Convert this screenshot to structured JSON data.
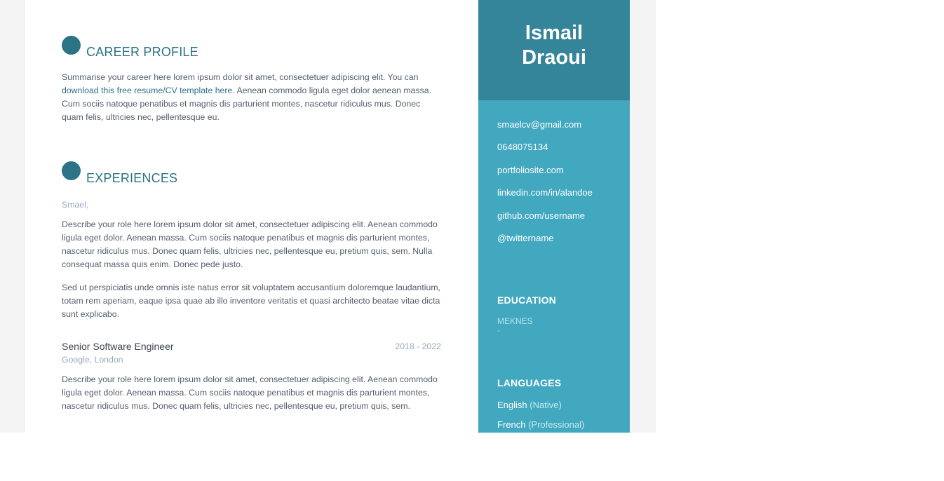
{
  "profile": {
    "first_name": "Ismail",
    "last_name": "Draoui",
    "contact": [
      {
        "label": "smaelcv@gmail.com",
        "icon": "email-icon"
      },
      {
        "label": "0648075134",
        "icon": "phone-icon"
      },
      {
        "label": "portfoliosite.com",
        "icon": "globe-icon"
      },
      {
        "label": "linkedin.com/in/alandoe",
        "icon": "linkedin-icon"
      },
      {
        "label": "github.com/username",
        "icon": "github-icon"
      },
      {
        "label": "@twittername",
        "icon": "twitter-icon"
      }
    ]
  },
  "education": {
    "heading": "EDUCATION",
    "school": "MEKNES",
    "detail": "-"
  },
  "languages": {
    "heading": "LANGUAGES",
    "items": [
      {
        "name": "English",
        "level": "(Native)"
      },
      {
        "name": "French",
        "level": "(Professional)"
      }
    ]
  },
  "career": {
    "heading": "CAREER PROFILE",
    "text_before": "Summarise your career here lorem ipsum dolor sit amet, consectetuer adipiscing elit. You can ",
    "link_text": "download this free resume/CV template here",
    "text_after": ". Aenean commodo ligula eget dolor aenean massa. Cum sociis natoque penatibus et magnis dis parturient montes, nascetur ridiculus mus. Donec quam felis, ultricies nec, pellentesque eu."
  },
  "experiences": {
    "heading": "EXPERIENCES",
    "entry1": {
      "subtitle": "Smael,",
      "paragraph1": "Describe your role here lorem ipsum dolor sit amet, consectetuer adipiscing elit. Aenean commodo ligula eget dolor. Aenean massa. Cum sociis natoque penatibus et magnis dis parturient montes, nascetur ridiculus mus. Donec quam felis, ultricies nec, pellentesque eu, pretium quis, sem. Nulla consequat massa quis enim. Donec pede justo.",
      "paragraph2": "Sed ut perspiciatis unde omnis iste natus error sit voluptatem accusantium doloremque laudantium, totam rem aperiam, eaque ipsa quae ab illo inventore veritatis et quasi architecto beatae vitae dicta sunt explicabo."
    },
    "entry2": {
      "title": "Senior Software Engineer",
      "dates": "2018 - 2022",
      "company": "Google, London",
      "paragraph": "Describe your role here lorem ipsum dolor sit amet, consectetuer adipiscing elit. Aenean commodo ligula eget dolor. Aenean massa. Cum sociis natoque penatibus et magnis dis parturient montes, nascetur ridiculus mus. Donec quam felis, ultricies nec, pellentesque eu, pretium quis, sem."
    }
  },
  "colors": {
    "sidebar": "#42a8c0",
    "name_box": "#35859a",
    "accent": "#2c7386",
    "text": "#545e6c",
    "muted": "#97aaba"
  }
}
